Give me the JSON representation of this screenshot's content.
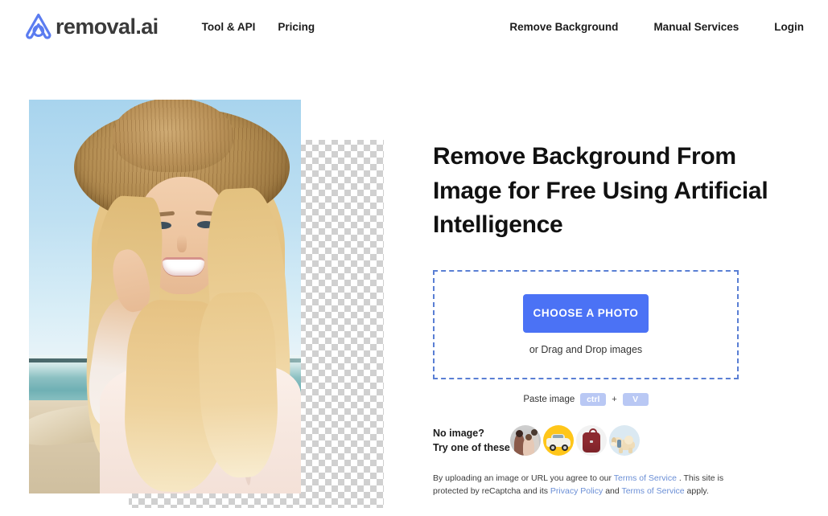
{
  "header": {
    "brand_name": "removal.ai",
    "logo_icon": "removal-ai-logo-icon",
    "nav_left": [
      {
        "label": "Tool & API"
      },
      {
        "label": "Pricing"
      }
    ],
    "nav_right": [
      {
        "label": "Remove Background"
      },
      {
        "label": "Manual Services"
      },
      {
        "label": "Login"
      }
    ]
  },
  "hero": {
    "headline": "Remove Background From Image for Free Using Artificial Intelligence",
    "demo_image_alt": "Woman in straw sun hat at the beach with background partially removed showing transparency checkerboard"
  },
  "uploader": {
    "choose_button_label": "CHOOSE A PHOTO",
    "drag_text": "or Drag and Drop images",
    "paste_label": "Paste image",
    "key_ctrl": "ctrl",
    "key_plus": "+",
    "key_v": "V"
  },
  "samples": {
    "line1": "No image?",
    "line2": "Try one of these",
    "thumbnails": [
      {
        "name": "sample-thumb-family",
        "alt": "Family portrait"
      },
      {
        "name": "sample-thumb-car",
        "alt": "Classic car on yellow background"
      },
      {
        "name": "sample-thumb-backpack",
        "alt": "Red backpack"
      },
      {
        "name": "sample-thumb-dog",
        "alt": "Golden retriever dogs"
      }
    ]
  },
  "legal": {
    "part1": "By uploading an image or URL you agree to our ",
    "link_terms_1": "Terms of Service",
    "part2": " . This site is protected by reCaptcha and its ",
    "link_privacy": "Privacy Policy",
    "part3": " and ",
    "link_terms_2": "Terms of Service",
    "part4": " apply."
  },
  "colors": {
    "brand_blue": "#4b72f5",
    "logo_blue": "#5b7cf0",
    "dashed_border": "#5a7fd4",
    "key_badge": "#b9c8f4",
    "link_blue": "#6b8fd6",
    "text_dark": "#1c1c1c"
  }
}
